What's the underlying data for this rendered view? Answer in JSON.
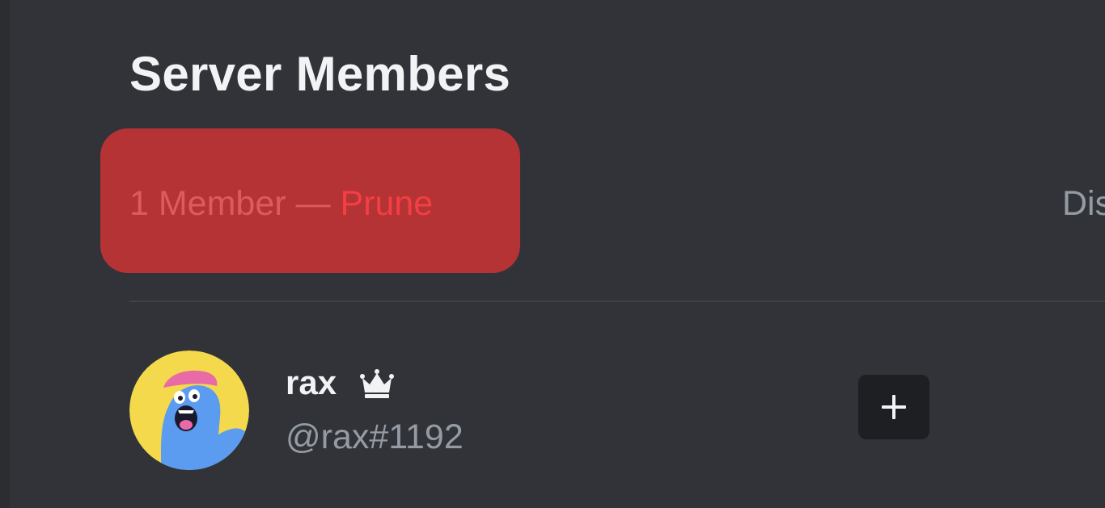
{
  "header": {
    "title": "Server Members"
  },
  "summary": {
    "count_label": "1 Member —",
    "prune_label": "Prune",
    "display_label": "Dis"
  },
  "members": [
    {
      "username": "rax",
      "tag": "@rax#1192",
      "is_owner": true,
      "badge_icon": "crown-icon",
      "avatar_icon": "avatar-cartoon-icon",
      "add_role_icon": "plus-icon"
    }
  ],
  "colors": {
    "background": "#313338",
    "highlight": "#b53235",
    "prune": "#f23f43",
    "muted_text": "#949ba4",
    "avatar_bg": "#f3d94b",
    "avatar_character": "#5b9cf0"
  }
}
